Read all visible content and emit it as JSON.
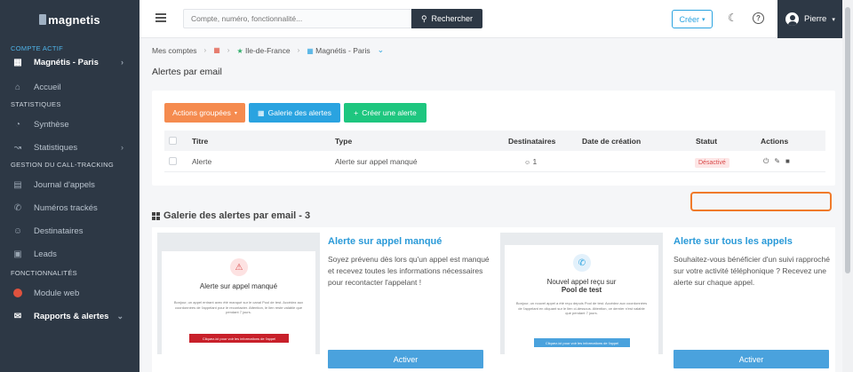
{
  "app": {
    "logo": "magnetis"
  },
  "sidebar": {
    "active_account_label": "COMPTE ACTIF",
    "account_name": "Magnétis - Paris",
    "sections": {
      "stats": "STATISTIQUES",
      "tracking": "GESTION DU CALL-TRACKING",
      "features": "FONCTIONNALITÉS"
    },
    "items": {
      "home": "Accueil",
      "summary": "Synthèse",
      "statistics": "Statistiques",
      "call_log": "Journal d'appels",
      "tracked_numbers": "Numéros trackés",
      "recipients": "Destinataires",
      "leads": "Leads",
      "web_module": "Module web",
      "reports": "Rapports & alertes"
    }
  },
  "topbar": {
    "search_placeholder": "Compte, numéro, fonctionnalité...",
    "search_button": "Rechercher",
    "create_button": "Créer",
    "user_name": "Pierre"
  },
  "breadcrumb": {
    "root": "Mes comptes",
    "region": "Ile-de-France",
    "account": "Magnétis - Paris"
  },
  "page_title": "Alertes par email",
  "toolbar": {
    "grouped_actions": "Actions groupées",
    "gallery": "Galerie des alertes",
    "create_alert": "Créer une alerte"
  },
  "table": {
    "headers": {
      "title": "Titre",
      "type": "Type",
      "recipients": "Destinataires",
      "created": "Date de création",
      "status": "Statut",
      "actions": "Actions"
    },
    "rows": [
      {
        "title": "Alerte",
        "type": "Alerte sur appel manqué",
        "recipients": "1",
        "created": "",
        "status": "Désactivé"
      }
    ]
  },
  "gallery": {
    "title": "Galerie des alertes par email - 3",
    "items": [
      {
        "name": "Alerte sur appel manqué",
        "description": "Soyez prévenu dès lors qu'un appel est manqué et recevez toutes les informations nécessaires pour recontacter l'appelant !",
        "preview_title": "Alerte sur appel manqué",
        "preview_text": "Bonjour, un appel entrant avec été manqué sur le canal Pool de test. Accédez aux coordonnées de l'appelant pour le recontacter. Attention, le lien reste valable que pendant 7 jours.",
        "preview_button": "Cliquez-ici pour voir les informations de l'appel",
        "button": "Activer"
      },
      {
        "name": "Alerte sur tous les appels",
        "description": "Souhaitez-vous bénéficier d'un suivi rapproché sur votre activité téléphonique ? Recevez une alerte sur chaque appel.",
        "preview_title": "Nouvel appel reçu sur",
        "preview_subtitle": "Pool de test",
        "preview_text": "Bonjour, un nouvel appel a été reçu depuis Pool de test. Accédez aux coordonnées de l'appelant en cliquant sur le lien ci-dessous. Attention, ce dernier n'est valable que pendant 7 jours.",
        "preview_button": "Cliquez-ici pour voir les informations de l'appel",
        "button": "Activer"
      }
    ]
  }
}
